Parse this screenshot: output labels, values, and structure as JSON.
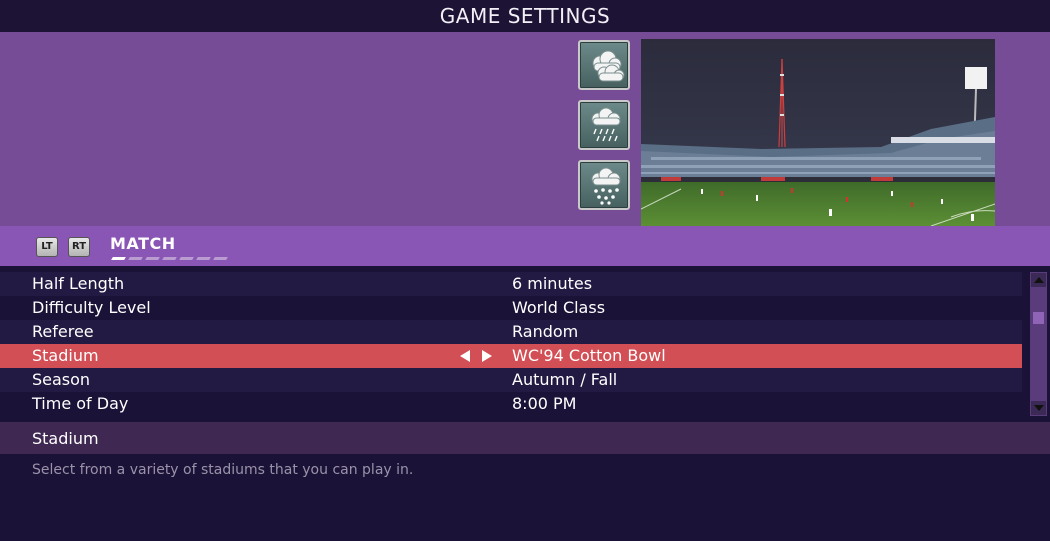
{
  "title": "GAME SETTINGS",
  "weather": {
    "options": [
      {
        "icon": "cloudy-icon"
      },
      {
        "icon": "rain-icon"
      },
      {
        "icon": "snow-icon"
      }
    ]
  },
  "tabs": {
    "left_trigger": "LT",
    "right_trigger": "RT",
    "current": "MATCH",
    "page_count": 7,
    "active_index": 0
  },
  "settings": [
    {
      "label": "Half Length",
      "value": "6 minutes"
    },
    {
      "label": "Difficulty Level",
      "value": "World Class"
    },
    {
      "label": "Referee",
      "value": "Random"
    },
    {
      "label": "Stadium",
      "value": "WC'94 Cotton Bowl"
    },
    {
      "label": "Season",
      "value": "Autumn / Fall"
    },
    {
      "label": "Time of Day",
      "value": "8:00 PM"
    }
  ],
  "selected_index": 3,
  "description": {
    "title": "Stadium",
    "text": "Select from a variety of stadiums that you can play in."
  },
  "colors": {
    "selected_row": "#d24f55",
    "banner": "#774c96",
    "tabbar": "#8a56b6"
  }
}
